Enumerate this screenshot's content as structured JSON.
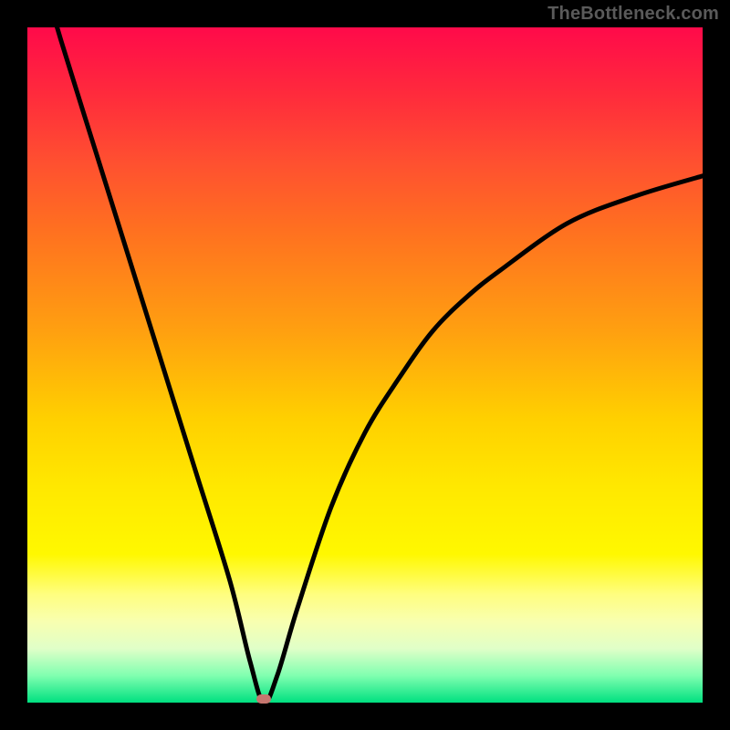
{
  "watermark": "TheBottleneck.com",
  "chart_data": {
    "type": "line",
    "title": "",
    "xlabel": "",
    "ylabel": "",
    "xlim": [
      0,
      100
    ],
    "ylim": [
      0,
      100
    ],
    "grid": false,
    "legend": null,
    "series": [
      {
        "name": "bottleneck-curve",
        "x": [
          0,
          5,
          10,
          15,
          20,
          25,
          30,
          33,
          35,
          37,
          40,
          45,
          50,
          55,
          60,
          65,
          70,
          80,
          90,
          100
        ],
        "values": [
          115,
          98,
          82,
          66,
          50,
          34,
          18,
          6,
          0,
          4,
          14,
          29,
          40,
          48,
          55,
          60,
          64,
          71,
          75,
          78
        ]
      }
    ],
    "marker": {
      "x": 35,
      "y": 0.5
    },
    "colors": {
      "curve": "#000000",
      "marker": "#c6766f"
    }
  }
}
